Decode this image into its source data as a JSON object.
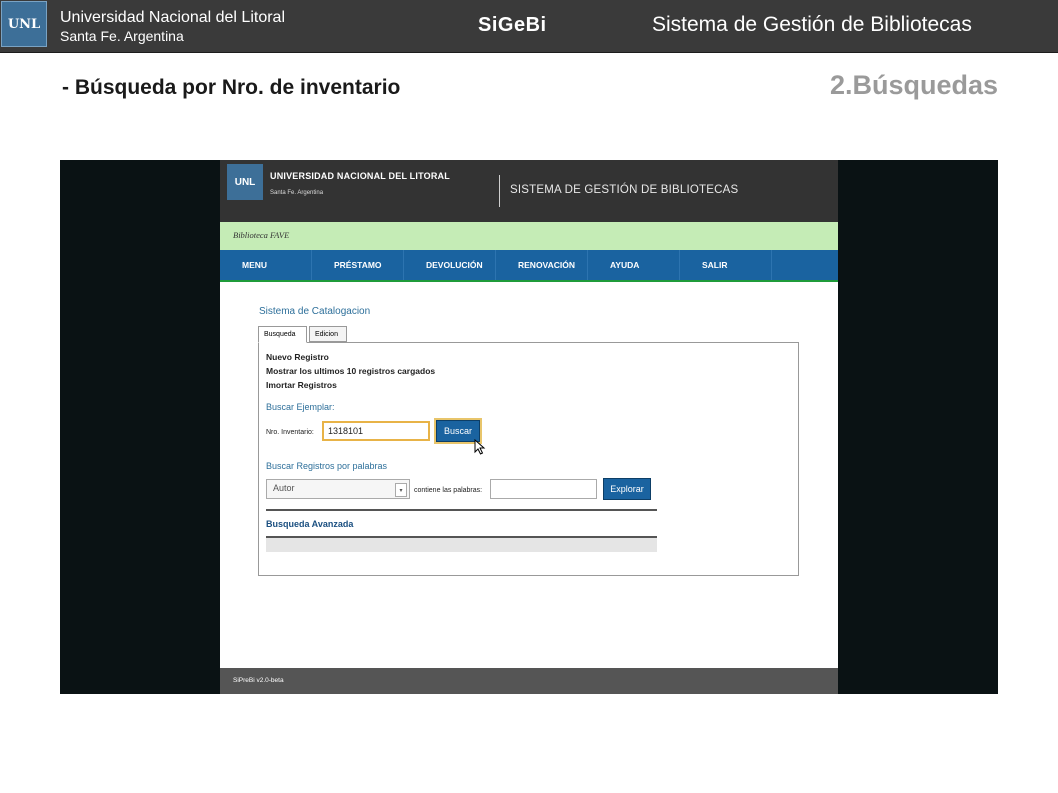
{
  "slide": {
    "logo_text": "UNL",
    "university": "Universidad Nacional del Litoral",
    "city": "Santa Fe. Argentina",
    "brand": "SiGeBi",
    "system_title": "Sistema de Gestión de Bibliotecas",
    "subtitle": "- Búsqueda por Nro. de inventario",
    "section": "2.Búsquedas"
  },
  "site": {
    "logo_text": "UNL",
    "university": "UNIVERSIDAD NACIONAL DEL LITORAL",
    "city": "Santa Fe. Argentina",
    "system_title": "SISTEMA DE GESTIÓN DE BIBLIOTECAS",
    "library": "Biblioteca FAVE",
    "menu": [
      "MENU",
      "PRÉSTAMO",
      "DEVOLUCIÓN",
      "RENOVACIÓN",
      "AYUDA",
      "SALIR"
    ],
    "catalog_title": "Sistema de Catalogacion",
    "tabs": [
      "Busqueda",
      "Edicion"
    ],
    "links": [
      "Nuevo Registro",
      "Mostrar los ultimos 10 registros cargados",
      "Imortar Registros"
    ],
    "buscar_ejemplar_label": "Buscar Ejemplar:",
    "inventario_label": "Nro. Inventario:",
    "inventario_value": "1318101",
    "buscar_button": "Buscar",
    "buscar_registros_label": "Buscar Registros por palabras",
    "field_select": "Autor",
    "contiene_label": "contiene las palabras:",
    "words_value": "",
    "explorar_button": "Explorar",
    "advanced_search": "Busqueda Avanzada",
    "footer": "SiPreBi v2.0-beta"
  },
  "colors": {
    "header_bg": "#3a3a3a",
    "menu_blue": "#1a63a0",
    "library_green": "#c5ecb6",
    "link_blue": "#2d6f9a"
  }
}
